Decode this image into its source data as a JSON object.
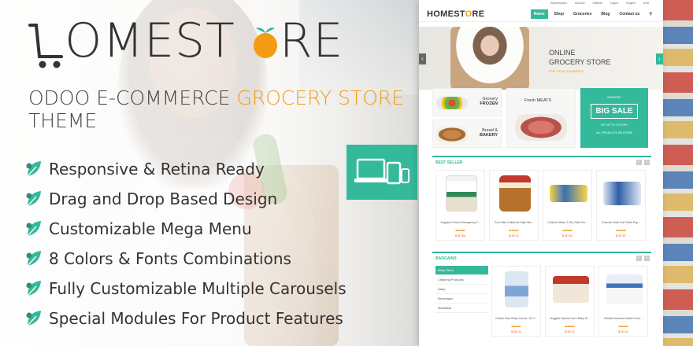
{
  "brand": {
    "logo_home": "HOME",
    "logo_st": "ST",
    "logo_o": "O",
    "logo_re": "RE"
  },
  "headline": {
    "line1_prefix": "ODOO E-COMMERCE ",
    "line1_accent": "GROCERY STORE",
    "line2": "THEME"
  },
  "features": [
    "Responsive & Retina Ready",
    "Drag and Drop Based Design",
    "Customizable Mega Menu",
    "8 Colors & Fonts Combinations",
    "Fully Customizable Multiple Carousels",
    "Special Modules For Product Features"
  ],
  "colors": {
    "accent": "#34b99a",
    "orange": "#f39c12",
    "leaf": "#34b99a"
  },
  "preview": {
    "topbar": [
      "Administrator",
      "Account",
      "Wishlist",
      "Logout",
      "English",
      "USA"
    ],
    "logo_home": "HOME",
    "logo_st": "ST",
    "logo_o": "O",
    "logo_re": "RE",
    "menu": [
      "Home",
      "Shop",
      "Groceries",
      "Blog",
      "Contact us"
    ],
    "hero": {
      "small": "ONLINE",
      "big": "GROCERY STORE",
      "sub": "FOR TRUE GOURMETS"
    },
    "categories": {
      "frozen_top": "Grocery",
      "frozen_bottom": "FROZEN",
      "bread_top": "Bread &",
      "bread_bottom": "BAKERY",
      "meats": "Fresh MEATS"
    },
    "sale": {
      "weekend": "WEEKEND",
      "big": "BIG SALE",
      "discount": "GET UP TO 70% OFF",
      "all": "ALL PRODUCTS ON STORE"
    },
    "best_seller": {
      "title": "BEST SELLER",
      "items": [
        {
          "name": "Augason Farms Emergency F...",
          "old": "$ 60.00",
          "price": "$ 50.64"
        },
        {
          "name": "Coro Mila California Style Ma...",
          "old": "$ 10.00",
          "price": "$ 30.11"
        },
        {
          "name": "Charmin Basic 1-Ply Toilet Pa...",
          "old": "$ 40.00",
          "price": "$ 40.51"
        },
        {
          "name": "Charmin Ultra Soft Toilet Pap...",
          "old": "$ 40.00",
          "price": "$ 30.57"
        }
      ]
    },
    "bargains": {
      "title": "BARGAINS",
      "categories": [
        "Baby Store",
        "Cleaning Products",
        "Dairy",
        "Beverages",
        "Breakfast"
      ],
      "items": [
        {
          "name": "Gerber Rice Baby Cereal, 16 O...",
          "old": "$ 20.00",
          "price": "$ 30.11"
        },
        {
          "name": "Huggies Natural Care Baby W...",
          "old": "$ 30.00",
          "price": "$ 30.11"
        },
        {
          "name": "Similac Advance Infant Form...",
          "old": "$ 30.00",
          "price": "$ 30.11"
        }
      ]
    }
  }
}
